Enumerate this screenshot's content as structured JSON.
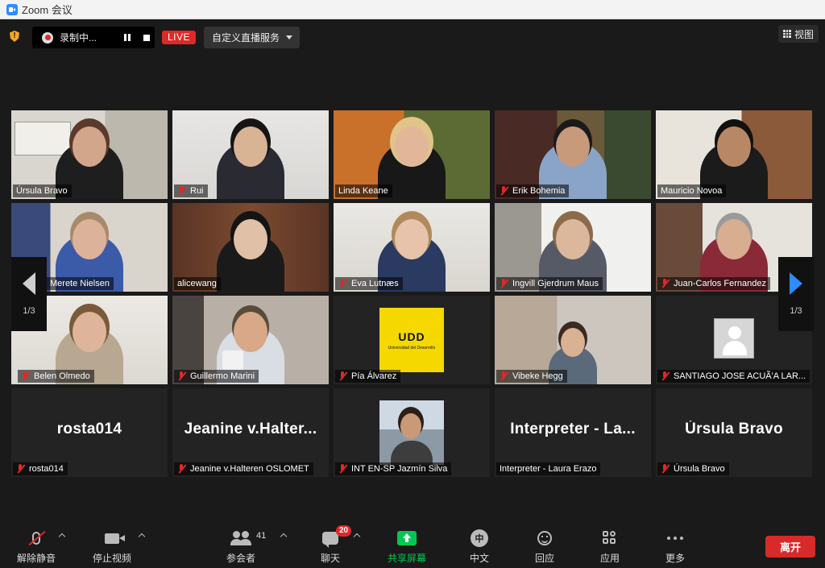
{
  "window": {
    "title": "Zoom 会议"
  },
  "topbar": {
    "recording_label": "录制中...",
    "live_label": "LIVE",
    "stream_label": "自定义直播服务",
    "view_label": "视图"
  },
  "pager": {
    "left_count": "1/3",
    "right_count": "1/3"
  },
  "tiles": [
    {
      "name": "Úrsula Bravo"
    },
    {
      "name": "Rui"
    },
    {
      "name": "Linda Keane"
    },
    {
      "name": "Erik Bohemia"
    },
    {
      "name": "Mauricio Novoa"
    },
    {
      "name": "Merete Nielsen"
    },
    {
      "name": "alicewang"
    },
    {
      "name": "Eva Lutnæs"
    },
    {
      "name": "Ingvill Gjerdrum Maus"
    },
    {
      "name": "Juan-Carlos Fernandez"
    },
    {
      "name": "Belen Olmedo"
    },
    {
      "name": "Guillermo Marini"
    },
    {
      "name": "Pía Álvarez"
    },
    {
      "name": "Vibeke Hegg"
    },
    {
      "name": "SANTIAGO JOSE ACUÃ'A LAR..."
    },
    {
      "name": "rosta014",
      "display": "rosta014"
    },
    {
      "name": "Jeanine v.Halteren OSLOMET",
      "display": "Jeanine  v.Halter..."
    },
    {
      "name": "INT EN-SP Jazmín Silva"
    },
    {
      "name": "Interpreter - Laura Erazo",
      "display": "Interpreter  -  La..."
    },
    {
      "name": "Úrsula Bravo",
      "display": "Úrsula Bravo"
    }
  ],
  "udd_logo": {
    "main": "UDD",
    "sub": "Universidad del Desarrollo"
  },
  "toolbar": {
    "unmute": "解除静音",
    "stop_video": "停止视频",
    "participants": "参会者",
    "participants_count": "41",
    "chat": "聊天",
    "chat_badge": "20",
    "share": "共享屏幕",
    "language": "中文",
    "language_icon": "中",
    "reactions": "回应",
    "apps": "应用",
    "more": "更多",
    "leave": "离开"
  },
  "colors": {
    "accent": "#2d8cff",
    "live_red": "#e02828",
    "share_green": "#00c853",
    "active_speaker": "#cfe25a"
  }
}
